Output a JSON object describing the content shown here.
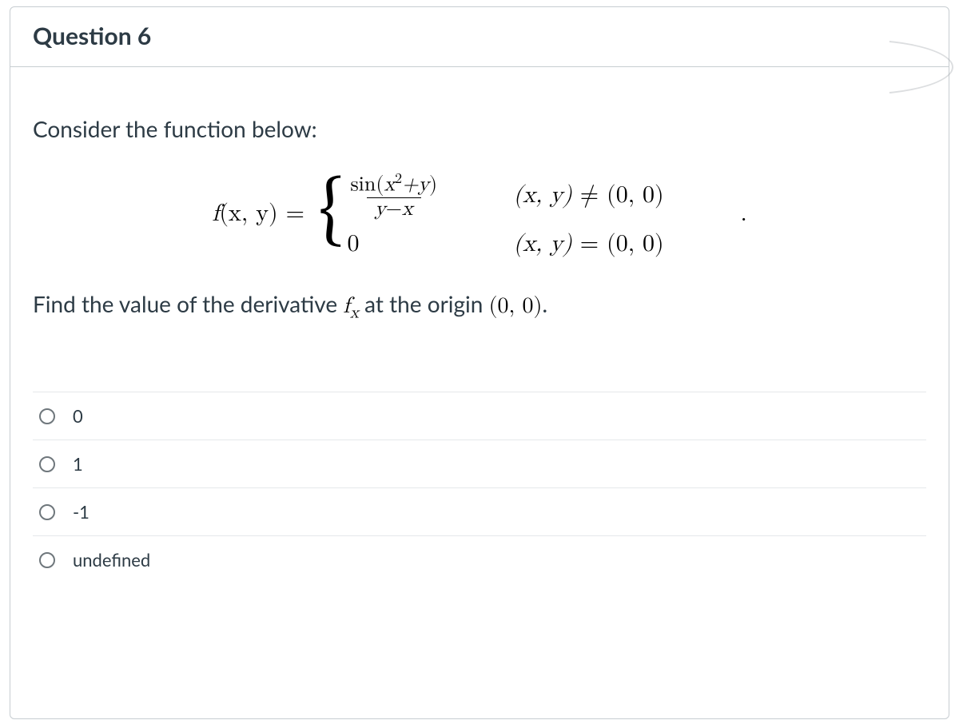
{
  "header": {
    "title": "Question 6"
  },
  "prompt": {
    "intro": "Consider the function below:",
    "func_lhs_f": "f",
    "func_lhs_args": "(x, y)",
    "equals": " = ",
    "frac_num_sin": "sin",
    "frac_num_inner_open": "(",
    "frac_num_x": "x",
    "frac_num_sup": "2",
    "frac_num_plus_y": "+y",
    "frac_num_inner_close": ")",
    "frac_den_y": "y",
    "frac_den_minus": "−",
    "frac_den_x": "x",
    "case2_value": "0",
    "cond1_xy": "(x, y)",
    "cond1_op": " ≠ ",
    "cond1_rhs": "(0, 0)",
    "cond2_xy": "(x, y)",
    "cond2_op": " = ",
    "cond2_rhs": "(0, 0)",
    "period": ".",
    "instruction_before": "Find the value of the derivative ",
    "instruction_fx_f": "f",
    "instruction_fx_sub": "x",
    "instruction_mid": " at the origin ",
    "instruction_origin": "(0, 0)",
    "instruction_after": "."
  },
  "options": [
    {
      "label": "0"
    },
    {
      "label": "1"
    },
    {
      "label": "-1"
    },
    {
      "label": "undefined"
    }
  ]
}
